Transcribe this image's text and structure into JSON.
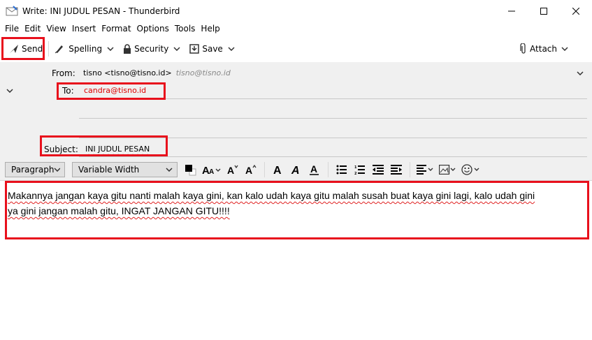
{
  "window": {
    "title": "Write: INI JUDUL PESAN - Thunderbird"
  },
  "menu": [
    "File",
    "Edit",
    "View",
    "Insert",
    "Format",
    "Options",
    "Tools",
    "Help"
  ],
  "toolbar": {
    "send": "Send",
    "spelling": "Spelling",
    "security": "Security",
    "save": "Save",
    "attach": "Attach"
  },
  "headers": {
    "from_label": "From:",
    "from_value": "tisno <tisno@tisno.id>",
    "from_alias": "tisno@tisno.id",
    "to_label": "To:",
    "to_value": "candra@tisno.id",
    "subject_label": "Subject:",
    "subject_value": "INI JUDUL PESAN"
  },
  "format": {
    "paragraph": "Paragraph",
    "font": "Variable Width"
  },
  "body": {
    "line1": "Makannya jangan kaya gitu nanti malah kaya gini, kan kalo udah kaya gitu malah susah buat kaya gini lagi, kalo udah gini",
    "line2": "ya gini jangan malah gitu, INGAT JANGAN GITU!!!!"
  },
  "colors": {
    "highlight": "#e8101c",
    "to_text": "#dd0000"
  }
}
